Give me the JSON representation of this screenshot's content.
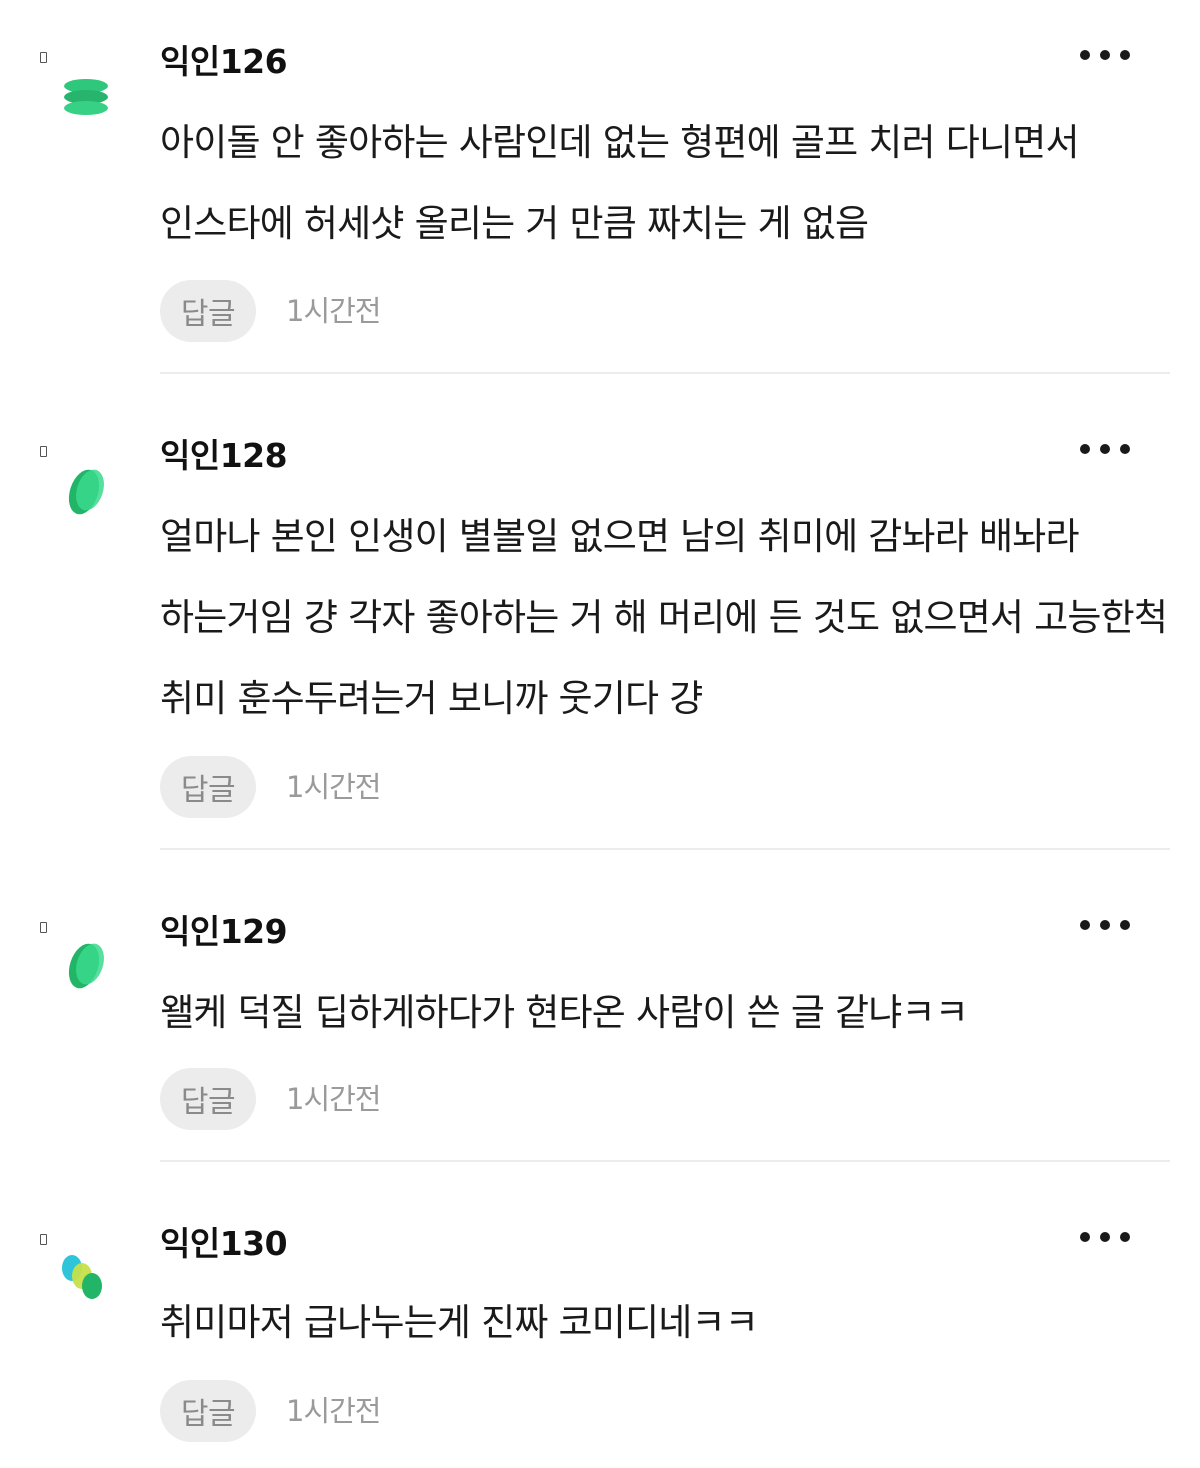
{
  "comments": [
    {
      "author": "익인126",
      "text": "아이돌 안 좋아하는 사람인데 없는 형편에 골프 치러 다니면서 인스타에 허세샷 올리는 거 만큼 짜치는 게 없음",
      "reply_label": "답글",
      "time": "1시간전",
      "avatar_icon": "green-stack-avatar-icon"
    },
    {
      "author": "익인128",
      "text": "얼마나 본인 인생이 별볼일 없으면 남의 취미에 감놔라 배놔라 하는거임 걍 각자 좋아하는 거 해 머리에 든 것도 없으면서 고능한척 취미 훈수두려는거 보니까 웃기다 걍",
      "reply_label": "답글",
      "time": "1시간전",
      "avatar_icon": "green-leaf-avatar-icon"
    },
    {
      "author": "익인129",
      "text": "왤케 덕질 딥하게하다가 현타온 사람이 쓴 글 같냐ㅋㅋ",
      "reply_label": "답글",
      "time": "1시간전",
      "avatar_icon": "green-leaf-avatar-icon"
    },
    {
      "author": "익인130",
      "text": "취미마저 급나누는게 진짜 코미디네ㅋㅋ",
      "reply_label": "답글",
      "time": "1시간전",
      "avatar_icon": "multicolor-dots-avatar-icon"
    }
  ],
  "colors": {
    "accent_green": "#2fc77b",
    "reply_bg": "#ececec",
    "muted_text": "#9a9a9a"
  }
}
